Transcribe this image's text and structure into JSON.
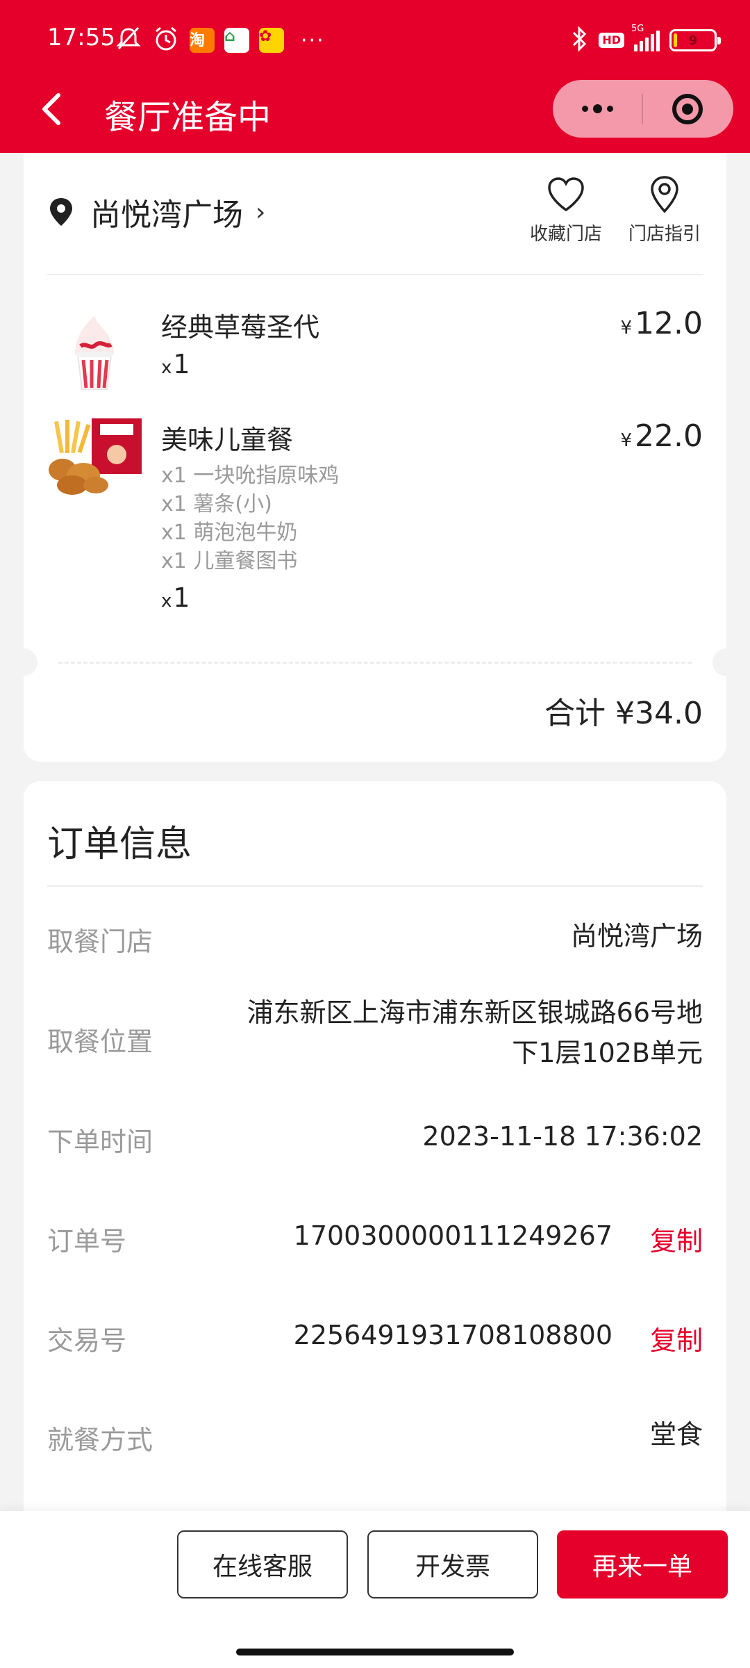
{
  "status_bar": {
    "time": "17:55",
    "dots": "···",
    "network": "5G",
    "hd": "HD",
    "battery_level": 9,
    "battery_text": "9"
  },
  "nav": {
    "title": "餐厅准备中"
  },
  "store": {
    "name": "尚悦湾广场",
    "favorite_label": "收藏门店",
    "guide_label": "门店指引"
  },
  "items": [
    {
      "name": "经典草莓圣代",
      "price_symbol": "¥",
      "price": "12.0",
      "qty_prefix": "x",
      "qty": "1"
    },
    {
      "name": "美味儿童餐",
      "price_symbol": "¥",
      "price": "22.0",
      "sub_items": [
        "x1 一块吮指原味鸡",
        "x1 薯条(小)",
        "x1 萌泡泡牛奶",
        "x1 儿童餐图书"
      ],
      "qty_prefix": "x",
      "qty": "1"
    }
  ],
  "total": "合计 ¥34.0",
  "order_info": {
    "title": "订单信息",
    "rows": [
      {
        "label": "取餐门店",
        "value": "尚悦湾广场"
      },
      {
        "label": "取餐位置",
        "value_line1": "浦东新区上海市浦东新区银城路66号地",
        "value_line2": "下1层102B单元"
      },
      {
        "label": "下单时间",
        "value": "2023-11-18 17:36:02"
      },
      {
        "label": "订单号",
        "value": "1700300000111249267",
        "action": "复制"
      },
      {
        "label": "交易号",
        "value": "2256491931708108800",
        "action": "复制"
      },
      {
        "label": "就餐方式",
        "value": "堂食"
      }
    ]
  },
  "actions": {
    "service": "在线客服",
    "invoice": "开发票",
    "reorder": "再来一单"
  },
  "colors": {
    "brand_red": "#e4002b",
    "background": "#f3f3f3"
  },
  "icons": {
    "back": "chevron-left-icon",
    "more": "more-dots-icon",
    "close": "target-close-icon",
    "location": "location-pin-icon",
    "favorite": "heart-icon",
    "guide": "map-pin-icon"
  }
}
